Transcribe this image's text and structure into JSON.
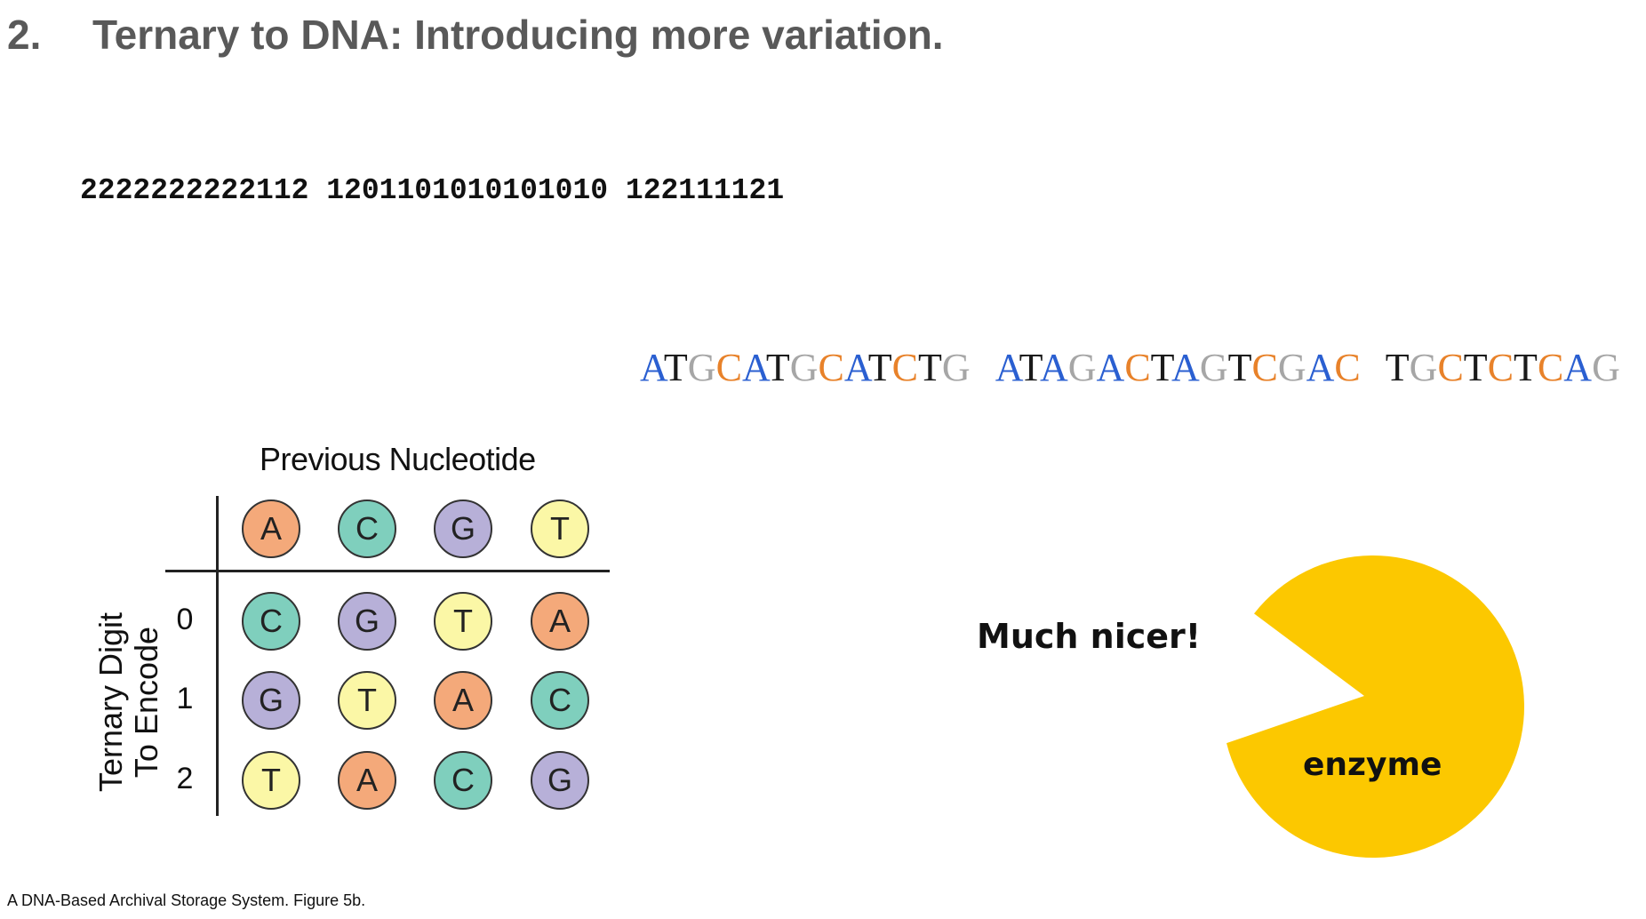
{
  "title": {
    "number": "2.",
    "text": "Ternary to DNA: Introducing more variation."
  },
  "ternary_sequence": "2222222222112 1201101010101010 122111121",
  "dna_groups": [
    [
      "A",
      "T",
      "G",
      "C",
      "A",
      "T",
      "G",
      "C",
      "A",
      "T",
      "C",
      "T",
      "G"
    ],
    [
      "A",
      "T",
      "A",
      "G",
      "A",
      "C",
      "T",
      "A",
      "G",
      "T",
      "C",
      "G",
      "A",
      "C"
    ],
    [
      "T",
      "G",
      "C",
      "T",
      "C",
      "T",
      "C",
      "A",
      "G"
    ]
  ],
  "dna_letter_colors": {
    "A": "#2a5fd1",
    "T": "#1a1a1a",
    "G": "#a6a6a6",
    "C": "#e8822a"
  },
  "encoding_table": {
    "column_header": "Previous Nucleotide",
    "row_header_line1": "Ternary Digit",
    "row_header_line2": "To Encode",
    "columns": [
      "A",
      "C",
      "G",
      "T"
    ],
    "rows": [
      {
        "digit": "0",
        "cells": [
          "C",
          "G",
          "T",
          "A"
        ]
      },
      {
        "digit": "1",
        "cells": [
          "G",
          "T",
          "A",
          "C"
        ]
      },
      {
        "digit": "2",
        "cells": [
          "T",
          "A",
          "C",
          "G"
        ]
      }
    ],
    "nucleotide_colors": {
      "A": "#f4a97a",
      "C": "#7fcfbd",
      "G": "#b7b0d8",
      "T": "#fbf7a6"
    }
  },
  "callout": "Much nicer!",
  "enzyme": {
    "label": "enzyme",
    "color": "#fcc800"
  },
  "caption": "A DNA-Based Archival Storage System. Figure 5b."
}
